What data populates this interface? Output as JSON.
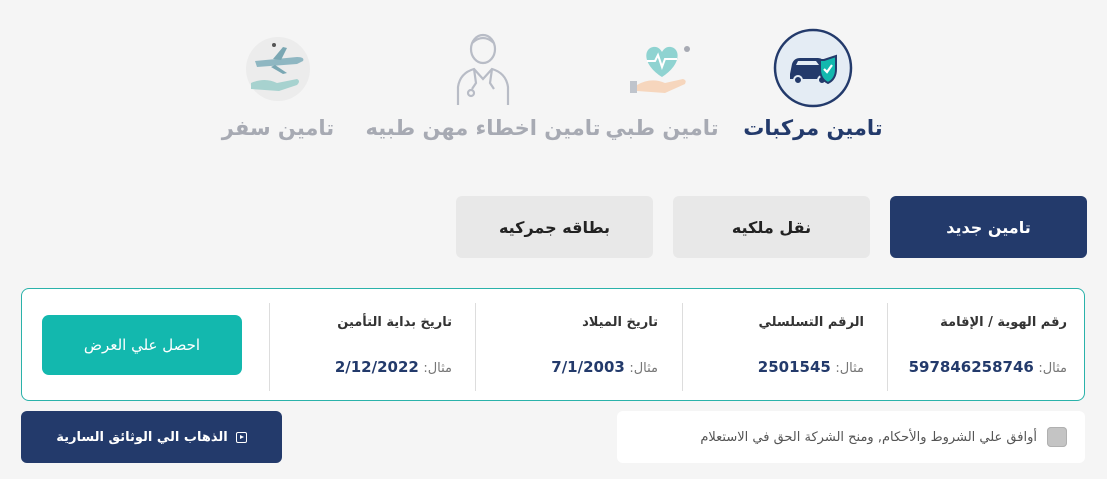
{
  "categories": [
    {
      "id": "vehicle",
      "label": "تامين مركبات",
      "icon": "car-shield-icon",
      "active": true
    },
    {
      "id": "medical",
      "label": "تامين طبي",
      "icon": "heart-hand-icon",
      "active": false
    },
    {
      "id": "malpractice",
      "label": "تامين اخطاء مهن طبيه",
      "icon": "doctor-icon",
      "active": false
    },
    {
      "id": "travel",
      "label": "تامين سفر",
      "icon": "plane-hand-icon",
      "active": false
    }
  ],
  "tabs": {
    "new_insurance": "تامين جديد",
    "ownership_transfer": "نقل ملكيه",
    "customs_card": "بطاقه جمركيه"
  },
  "form": {
    "id_field": {
      "label": "رقم الهوية / الإقامة",
      "prefix": "مثال:",
      "example": "597846258746"
    },
    "serial_field": {
      "label": "الرقم التسلسلي",
      "prefix": "مثال:",
      "example": "2501545"
    },
    "dob_field": {
      "label": "تاريخ الميلاد",
      "prefix": "مثال:",
      "example": "7/1/2003"
    },
    "start_field": {
      "label": "تاريخ بداية التأمين",
      "prefix": "مثال:",
      "example": "2/12/2022"
    },
    "quote_button": "احصل علي العرض"
  },
  "terms": {
    "text": "أوافق علي الشروط والأحكام, ومنح الشركة الحق في الاستعلام",
    "checked": false
  },
  "docs_button": {
    "label": "الذهاب الي الوثائق السارية",
    "icon": "play-square-icon"
  },
  "colors": {
    "navy": "#233a6b",
    "teal": "#13b8ae",
    "muted": "#a7aab3"
  }
}
